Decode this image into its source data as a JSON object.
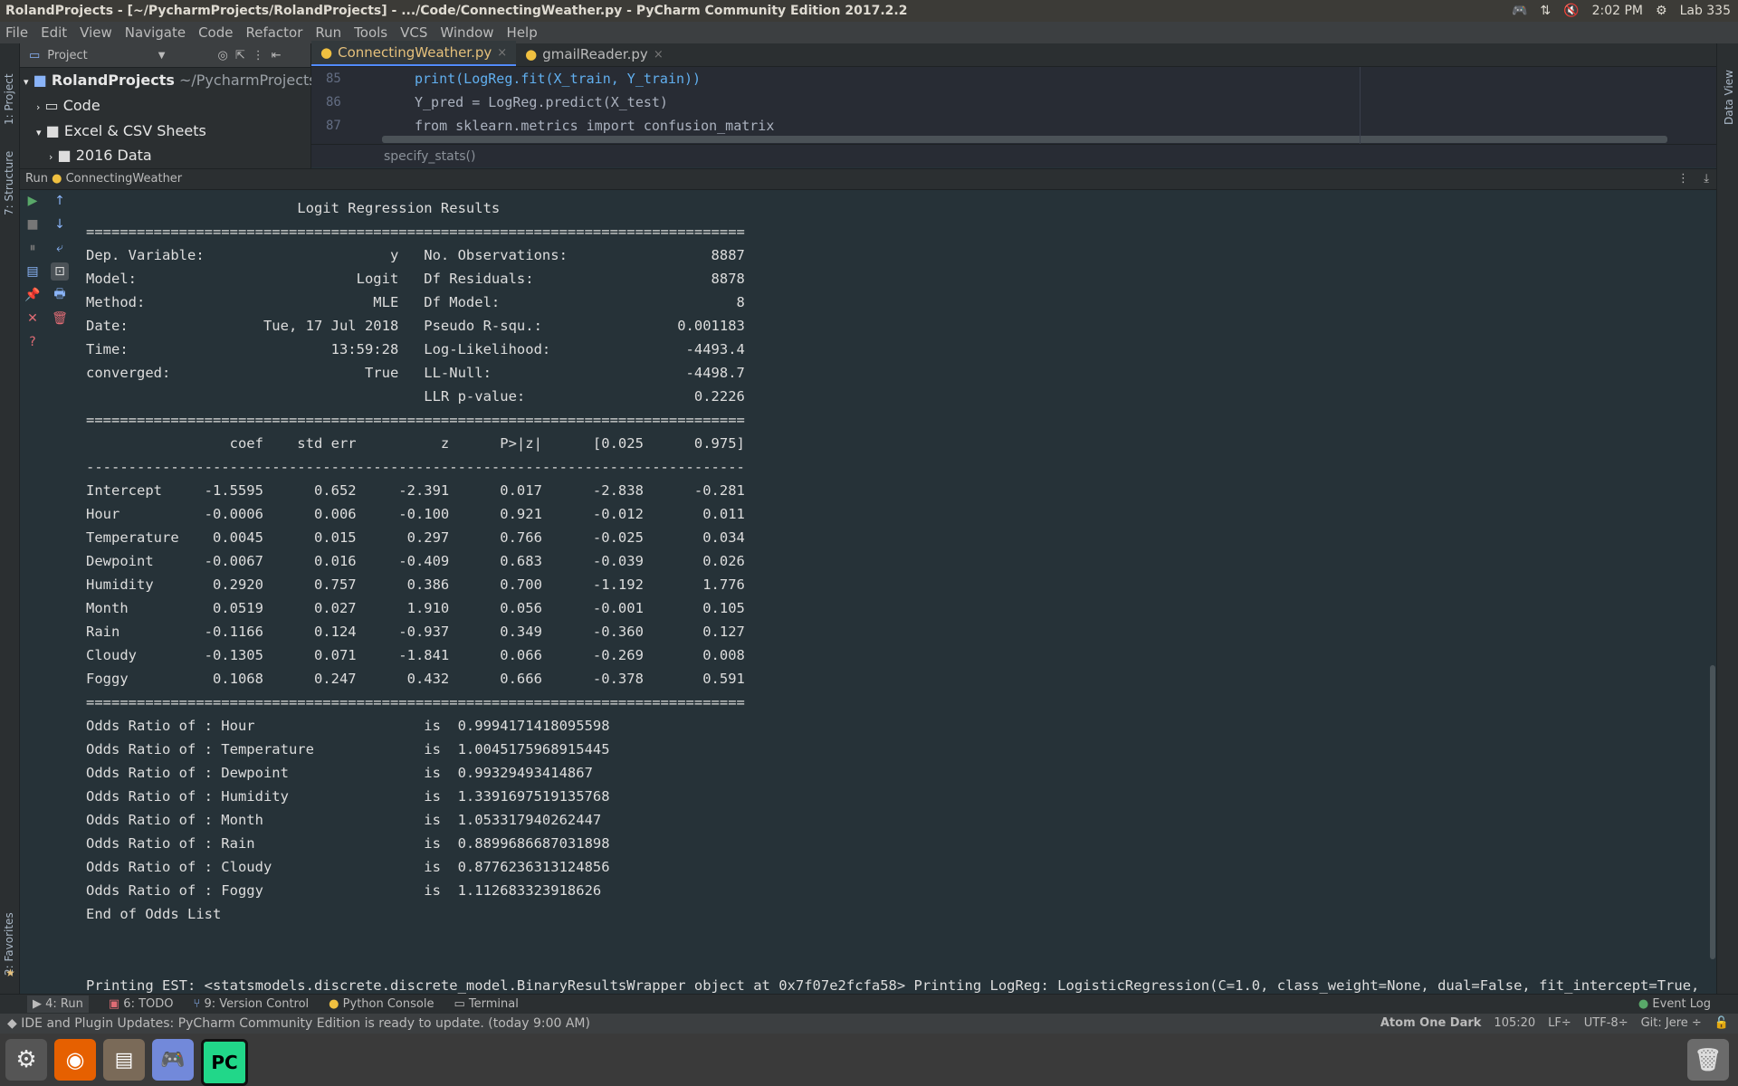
{
  "window": {
    "title": "RolandProjects - [~/PycharmProjects/RolandProjects] - .../Code/ConnectingWeather.py - PyCharm Community Edition 2017.2.2",
    "tray": {
      "time": "2:02 PM",
      "session": "Lab 335"
    }
  },
  "menu": [
    "File",
    "Edit",
    "View",
    "Navigate",
    "Code",
    "Refactor",
    "Run",
    "Tools",
    "VCS",
    "Window",
    "Help"
  ],
  "left_strip": {
    "project": "1: Project",
    "structure": "7: Structure",
    "favorites": "2: Favorites"
  },
  "right_strip": {
    "data_view": "Data View"
  },
  "project": {
    "header": "Project",
    "root_name": "RolandProjects",
    "root_path": "~/PycharmProjects/Rol",
    "items": [
      "Code",
      "Excel & CSV Sheets",
      "2016 Data"
    ]
  },
  "tabs": [
    {
      "label": "ConnectingWeather.py",
      "close": "×"
    },
    {
      "label": "gmailReader.py",
      "close": "×"
    }
  ],
  "editor": {
    "line_numbers": [
      "85",
      "86",
      "87"
    ],
    "lines": [
      "print(LogReg.fit(X_train, Y_train))",
      "Y_pred = LogReg.predict(X_test)",
      "from sklearn.metrics import confusion_matrix"
    ],
    "breadcrumb": "specify_stats()"
  },
  "run": {
    "label": "Run",
    "config": "ConnectingWeather"
  },
  "console": {
    "title": "                         Logit Regression Results",
    "rule_eq": "==============================================================================",
    "rule_dash": "------------------------------------------------------------------------------",
    "summary": [
      "Dep. Variable:                      y   No. Observations:                 8887",
      "Model:                          Logit   Df Residuals:                     8878",
      "Method:                           MLE   Df Model:                            8",
      "Date:                Tue, 17 Jul 2018   Pseudo R-squ.:                0.001183",
      "Time:                        13:59:28   Log-Likelihood:                -4493.4",
      "converged:                       True   LL-Null:                       -4498.7",
      "                                        LLR p-value:                    0.2226"
    ],
    "coef_header": "                 coef    std err          z      P>|z|      [0.025      0.975]",
    "coef_rows": [
      "Intercept     -1.5595      0.652     -2.391      0.017      -2.838      -0.281",
      "Hour          -0.0006      0.006     -0.100      0.921      -0.012       0.011",
      "Temperature    0.0045      0.015      0.297      0.766      -0.025       0.034",
      "Dewpoint      -0.0067      0.016     -0.409      0.683      -0.039       0.026",
      "Humidity       0.2920      0.757      0.386      0.700      -1.192       1.776",
      "Month          0.0519      0.027      1.910      0.056      -0.001       0.105",
      "Rain          -0.1166      0.124     -0.937      0.349      -0.360       0.127",
      "Cloudy        -0.1305      0.071     -1.841      0.066      -0.269       0.008",
      "Foggy          0.1068      0.247      0.432      0.666      -0.378       0.591"
    ],
    "odds_rows": [
      "Odds Ratio of : Hour                    is  0.9994171418095598",
      "Odds Ratio of : Temperature             is  1.0045175968915445",
      "Odds Ratio of : Dewpoint                is  0.99329493414867",
      "Odds Ratio of : Humidity                is  1.3391697519135768",
      "Odds Ratio of : Month                   is  1.053317940262447",
      "Odds Ratio of : Rain                    is  0.8899686687031898",
      "Odds Ratio of : Cloudy                  is  0.8776236313124856",
      "Odds Ratio of : Foggy                   is  1.112683323918626"
    ],
    "end": "End of Odds List",
    "last_line": "Printing EST: <statsmodels.discrete.discrete_model.BinaryResultsWrapper object at 0x7f07e2fcfa58> Printing LogReg: LogisticRegression(C=1.0, class_weight=None, dual=False, fit_intercept=True,"
  },
  "bottom_tabs": [
    "4: Run",
    "6: TODO",
    "9: Version Control",
    "Python Console",
    "Terminal"
  ],
  "event_log": "Event Log",
  "status": {
    "message": "IDE and Plugin Updates: PyCharm Community Edition is ready to update. (today 9:00 AM)",
    "theme": "Atom One Dark",
    "position": "105:20",
    "line_sep": "LF÷",
    "encoding": "UTF-8÷",
    "git": "Git: Jere ÷"
  },
  "dock": {
    "pycharm_label": "PC"
  }
}
